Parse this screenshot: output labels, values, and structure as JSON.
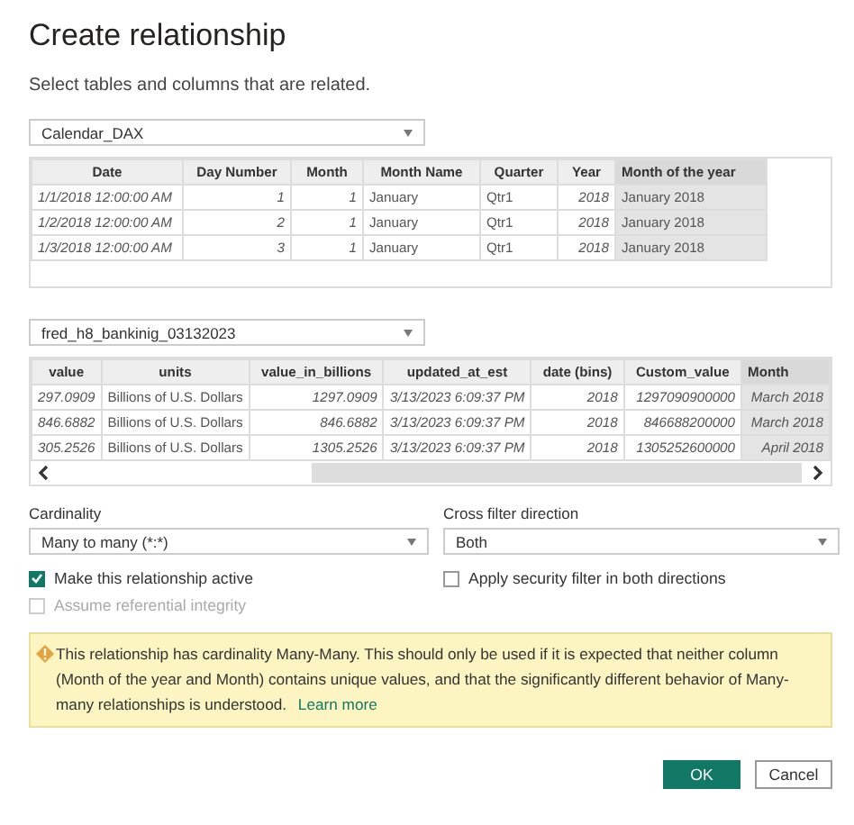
{
  "dialog": {
    "title": "Create relationship",
    "subtitle": "Select tables and columns that are related."
  },
  "tables": [
    {
      "dropdown": "Calendar_DAX",
      "scrollbar": false,
      "columns": [
        {
          "label": "Date",
          "kind": "datetime",
          "selected": false
        },
        {
          "label": "Day Number",
          "kind": "number",
          "selected": false
        },
        {
          "label": "Month",
          "kind": "number",
          "selected": false
        },
        {
          "label": "Month Name",
          "kind": "text",
          "selected": false
        },
        {
          "label": "Quarter",
          "kind": "text",
          "selected": false
        },
        {
          "label": "Year",
          "kind": "number",
          "selected": false
        },
        {
          "label": "Month of the year",
          "kind": "text",
          "selected": true
        }
      ],
      "rows": [
        [
          "1/1/2018 12:00:00 AM",
          "1",
          "1",
          "January",
          "Qtr1",
          "2018",
          "January 2018"
        ],
        [
          "1/2/2018 12:00:00 AM",
          "2",
          "1",
          "January",
          "Qtr1",
          "2018",
          "January 2018"
        ],
        [
          "1/3/2018 12:00:00 AM",
          "3",
          "1",
          "January",
          "Qtr1",
          "2018",
          "January 2018"
        ]
      ]
    },
    {
      "dropdown": "fred_h8_bankinig_03132023",
      "scrollbar": true,
      "columns": [
        {
          "label": "value",
          "kind": "number",
          "selected": false
        },
        {
          "label": "units",
          "kind": "text",
          "selected": false
        },
        {
          "label": "value_in_billions",
          "kind": "number",
          "selected": false
        },
        {
          "label": "updated_at_est",
          "kind": "number",
          "selected": false
        },
        {
          "label": "date (bins)",
          "kind": "number",
          "selected": false
        },
        {
          "label": "Custom_value",
          "kind": "number",
          "selected": false
        },
        {
          "label": "Month",
          "kind": "number",
          "selected": true
        }
      ],
      "rows": [
        [
          "297.0909",
          "Billions of U.S. Dollars",
          "1297.0909",
          "3/13/2023 6:09:37 PM",
          "2018",
          "1297090900000",
          "March 2018"
        ],
        [
          "846.6882",
          "Billions of U.S. Dollars",
          "846.6882",
          "3/13/2023 6:09:37 PM",
          "2018",
          "846688200000",
          "March 2018"
        ],
        [
          "305.2526",
          "Billions of U.S. Dollars",
          "1305.2526",
          "3/13/2023 6:09:37 PM",
          "2018",
          "1305252600000",
          "April 2018"
        ]
      ]
    }
  ],
  "cardinality": {
    "label": "Cardinality",
    "value": "Many to many (*:*)"
  },
  "cross_filter": {
    "label": "Cross filter direction",
    "value": "Both"
  },
  "checkboxes": [
    {
      "label": "Make this relationship active",
      "checked": true,
      "disabled": false
    },
    {
      "label": "Apply security filter in both directions",
      "checked": false,
      "disabled": false
    },
    {
      "label": "Assume referential integrity",
      "checked": false,
      "disabled": true
    }
  ],
  "warning": {
    "text": "This relationship has cardinality Many-Many. This should only be used if it is expected that neither column (Month of the year and Month) contains unique values, and that the significantly different behavior of Many-many relationships is understood.",
    "link": "Learn more"
  },
  "buttons": [
    {
      "label": "OK",
      "kind": "primary"
    },
    {
      "label": "Cancel",
      "kind": "secondary"
    }
  ]
}
